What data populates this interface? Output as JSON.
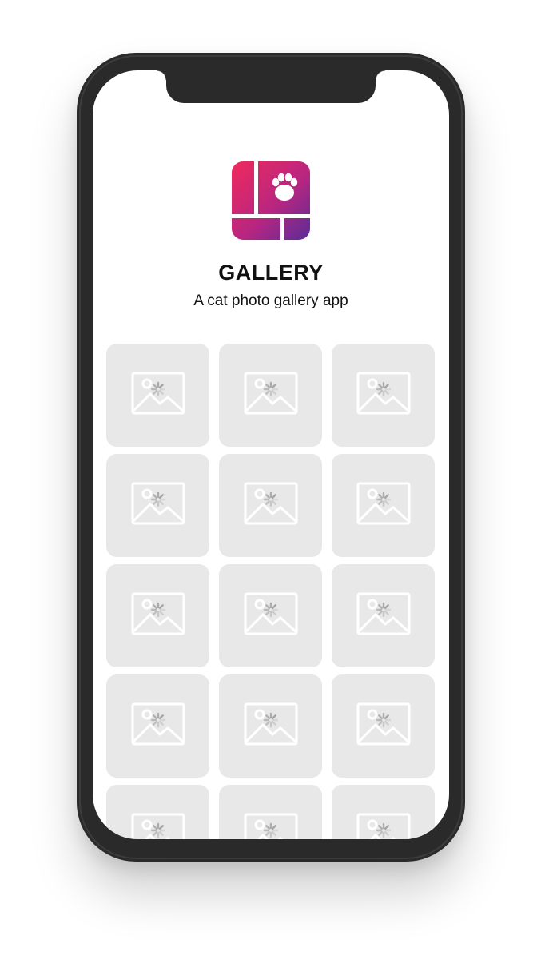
{
  "app": {
    "title": "GALLERY",
    "subtitle": "A cat photo gallery app",
    "logo_icon": "paw-gallery-icon",
    "brand_gradient": [
      "#e8265e",
      "#c3247a",
      "#5e2b95"
    ]
  },
  "gallery": {
    "tile_icon": "image-loading-placeholder-icon",
    "tile_color": "#e8e8e8",
    "placeholder_count": 15
  }
}
